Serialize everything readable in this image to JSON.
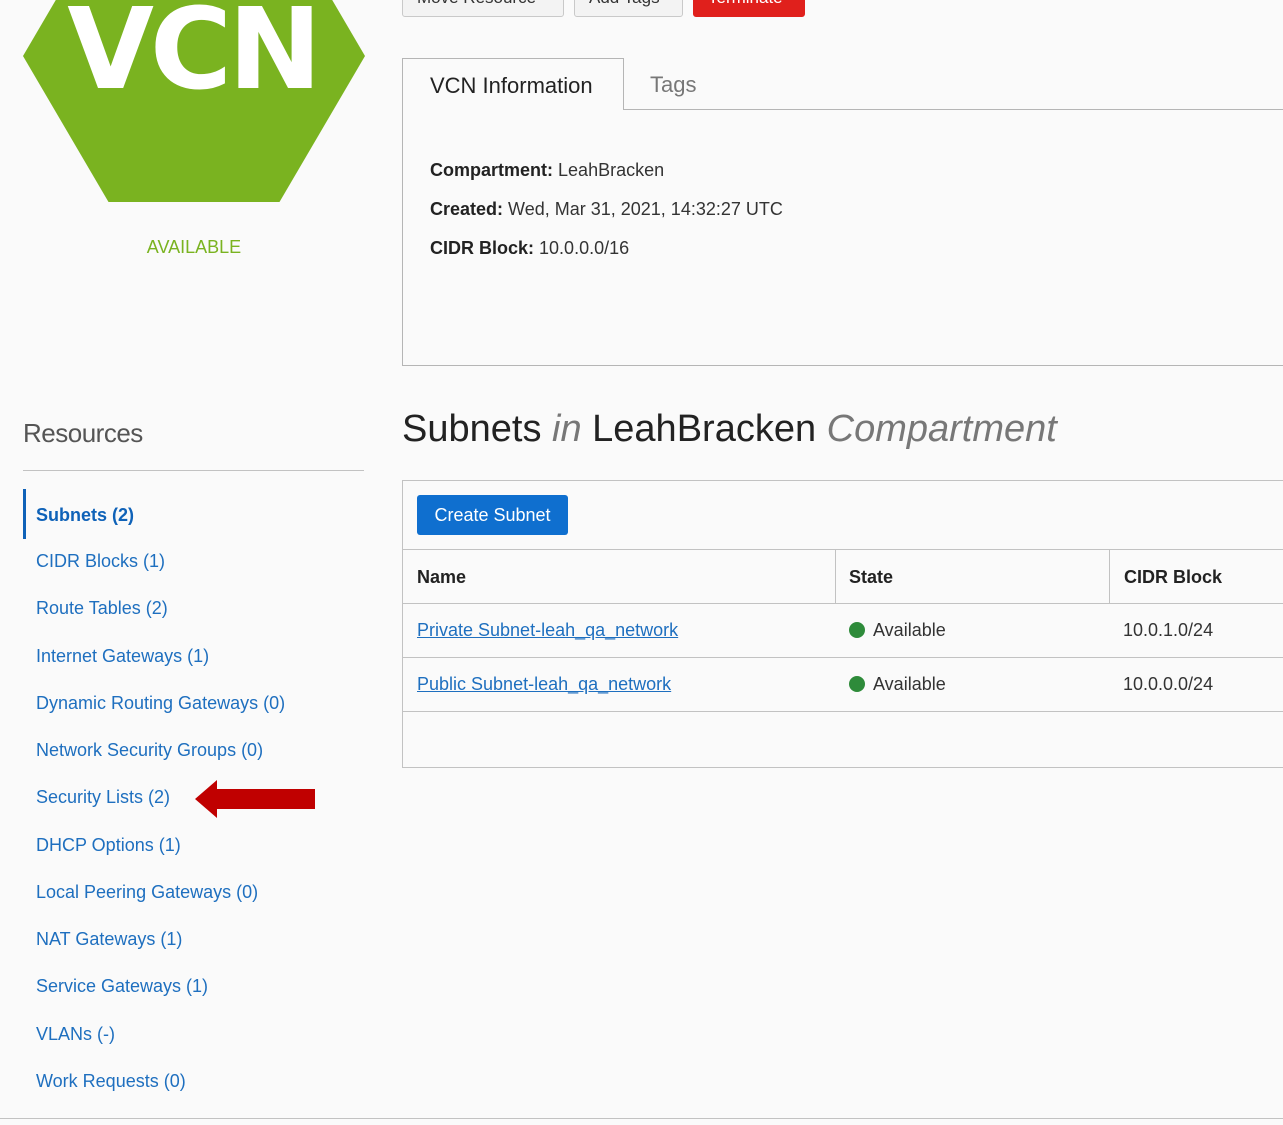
{
  "vcn": {
    "icon_text": "VCN",
    "status": "AVAILABLE"
  },
  "colors": {
    "brand_green": "#7ab320",
    "link_blue": "#1e6fbf",
    "primary_button": "#0f6fcf",
    "danger_button": "#e0201c",
    "status_dot": "#2e8b3a",
    "arrow": "#c00000"
  },
  "actions": {
    "move_resource": "Move Resource",
    "add_tags": "Add Tags",
    "terminate": "Terminate"
  },
  "tabs": [
    {
      "label": "VCN Information",
      "active": true
    },
    {
      "label": "Tags",
      "active": false
    }
  ],
  "info": {
    "compartment_label": "Compartment:",
    "compartment_value": "LeahBracken",
    "created_label": "Created:",
    "created_value": "Wed, Mar 31, 2021, 14:32:27 UTC",
    "cidr_label": "CIDR Block:",
    "cidr_value": "10.0.0.0/16"
  },
  "resources": {
    "title": "Resources",
    "items": [
      {
        "label": "Subnets (2)",
        "active": true
      },
      {
        "label": "CIDR Blocks (1)"
      },
      {
        "label": "Route Tables (2)"
      },
      {
        "label": "Internet Gateways (1)"
      },
      {
        "label": "Dynamic Routing Gateways (0)"
      },
      {
        "label": "Network Security Groups (0)"
      },
      {
        "label": "Security Lists (2)"
      },
      {
        "label": "DHCP Options (1)"
      },
      {
        "label": "Local Peering Gateways (0)"
      },
      {
        "label": "NAT Gateways (1)"
      },
      {
        "label": "Service Gateways (1)"
      },
      {
        "label": "VLANs (-)"
      },
      {
        "label": "Work Requests (0)"
      }
    ]
  },
  "subnets": {
    "heading_main": "Subnets",
    "heading_in": "in",
    "heading_compartment": "LeahBracken",
    "heading_suffix": "Compartment",
    "create_button": "Create Subnet",
    "columns": [
      "Name",
      "State",
      "CIDR Block"
    ],
    "rows": [
      {
        "name": "Private Subnet-leah_qa_network",
        "state": "Available",
        "cidr": "10.0.1.0/24"
      },
      {
        "name": "Public Subnet-leah_qa_network",
        "state": "Available",
        "cidr": "10.0.0.0/24"
      }
    ]
  }
}
